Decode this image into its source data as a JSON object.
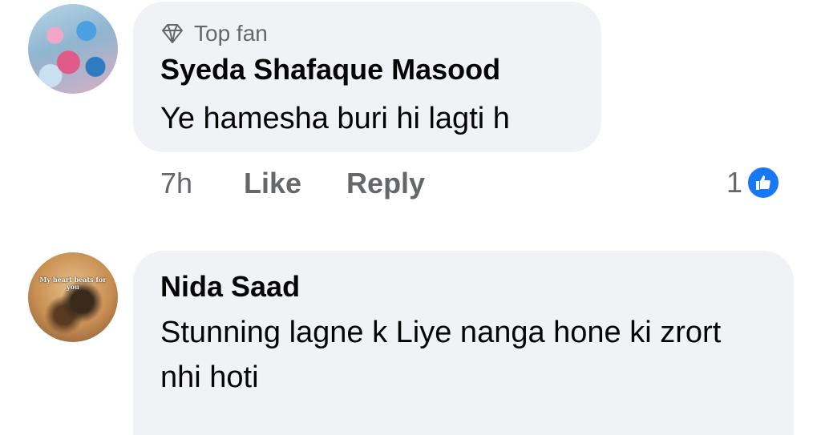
{
  "comments": [
    {
      "badge": "Top fan",
      "badge_icon": "diamond-icon",
      "author": "Syeda Shafaque Masood",
      "text": "Ye hamesha buri hi lagti h",
      "time": "7h",
      "like_label": "Like",
      "reply_label": "Reply",
      "reaction_count": "1",
      "reaction_icon": "like-reaction-icon"
    },
    {
      "author": "Nida Saad",
      "text": "Stunning lagne k Liye nanga hone ki zrort nhi hoti",
      "avatar_text": "My heart beats for you"
    }
  ],
  "colors": {
    "bubble": "#f0f2f5",
    "secondary_text": "#65676b",
    "like_blue": "#1877f2"
  }
}
